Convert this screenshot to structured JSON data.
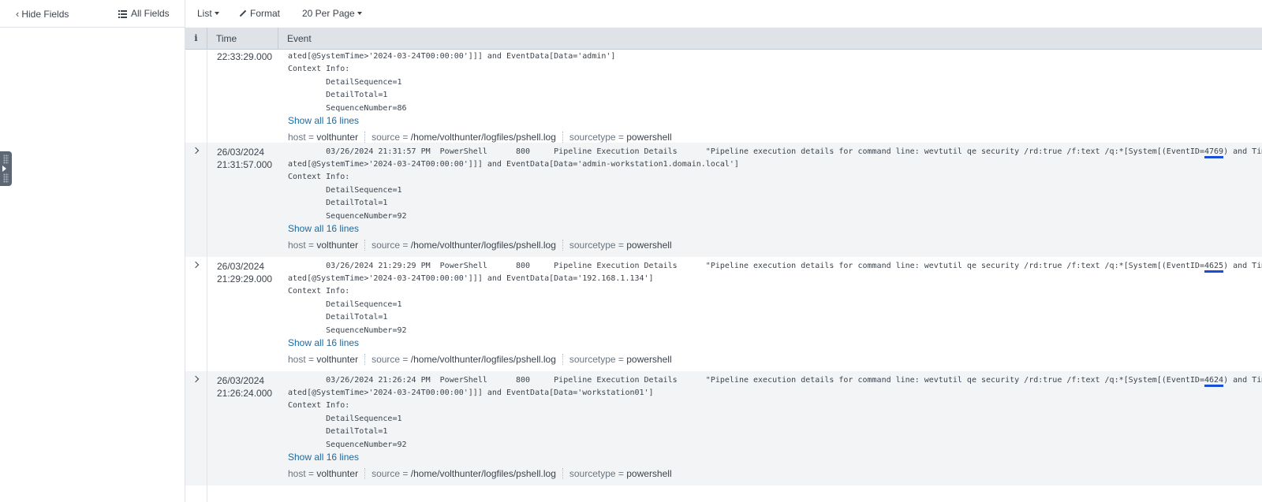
{
  "sidebar": {
    "hide_fields_label": "Hide Fields",
    "all_fields_label": "All Fields"
  },
  "toolbar": {
    "list_label": "List",
    "format_label": "Format",
    "per_page_label": "20 Per Page"
  },
  "table": {
    "info_header": "i",
    "time_header": "Time",
    "event_header": "Event"
  },
  "rows": [
    {
      "time_date": "",
      "time_clock": "22:33:29.000",
      "line1": "",
      "line2": "ated[@SystemTime>'2024-03-24T00:00:00']]] and EventData[Data='admin']",
      "ctx": "Context Info:",
      "seq": "        DetailSequence=1",
      "total": "        DetailTotal=1",
      "seqnum": "        SequenceNumber=86",
      "show_all": "Show all 16 lines",
      "host_key": "host = ",
      "host_val": "volthunter",
      "source_key": "source = ",
      "source_val": "/home/volthunter/logfiles/pshell.log",
      "sourcetype_key": "sourcetype = ",
      "sourcetype_val": "powershell"
    },
    {
      "time_date": "26/03/2024",
      "time_clock": "21:31:57.000",
      "line1_pre": "        03/26/2024 21:31:57 PM  PowerShell      800     Pipeline Execution Details      \"Pipeline execution details for command line: wevtutil qe security /rd:true /f:text /q:*[System[(EventID=",
      "line1_hl": "4769",
      "line1_post": ") and TimeCre",
      "line2": "ated[@SystemTime>'2024-03-24T00:00:00']]] and EventData[Data='admin-workstation1.domain.local']",
      "ctx": "Context Info:",
      "seq": "        DetailSequence=1",
      "total": "        DetailTotal=1",
      "seqnum": "        SequenceNumber=92",
      "show_all": "Show all 16 lines",
      "host_key": "host = ",
      "host_val": "volthunter",
      "source_key": "source = ",
      "source_val": "/home/volthunter/logfiles/pshell.log",
      "sourcetype_key": "sourcetype = ",
      "sourcetype_val": "powershell"
    },
    {
      "time_date": "26/03/2024",
      "time_clock": "21:29:29.000",
      "line1_pre": "        03/26/2024 21:29:29 PM  PowerShell      800     Pipeline Execution Details      \"Pipeline execution details for command line: wevtutil qe security /rd:true /f:text /q:*[System[(EventID=",
      "line1_hl": "4625",
      "line1_post": ") and TimeCre",
      "line2": "ated[@SystemTime>'2024-03-24T00:00:00']]] and EventData[Data='192.168.1.134']",
      "ctx": "Context Info:",
      "seq": "        DetailSequence=1",
      "total": "        DetailTotal=1",
      "seqnum": "        SequenceNumber=92",
      "show_all": "Show all 16 lines",
      "host_key": "host = ",
      "host_val": "volthunter",
      "source_key": "source = ",
      "source_val": "/home/volthunter/logfiles/pshell.log",
      "sourcetype_key": "sourcetype = ",
      "sourcetype_val": "powershell"
    },
    {
      "time_date": "26/03/2024",
      "time_clock": "21:26:24.000",
      "line1_pre": "        03/26/2024 21:26:24 PM  PowerShell      800     Pipeline Execution Details      \"Pipeline execution details for command line: wevtutil qe security /rd:true /f:text /q:*[System[(EventID=",
      "line1_hl": "4624",
      "line1_post": ") and TimeCre",
      "line2": "ated[@SystemTime>'2024-03-24T00:00:00']]] and EventData[Data='workstation01']",
      "ctx": "Context Info:",
      "seq": "        DetailSequence=1",
      "total": "        DetailTotal=1",
      "seqnum": "        SequenceNumber=92",
      "show_all": "Show all 16 lines",
      "host_key": "host = ",
      "host_val": "volthunter",
      "source_key": "source = ",
      "source_val": "/home/volthunter/logfiles/pshell.log",
      "sourcetype_key": "sourcetype = ",
      "sourcetype_val": "powershell"
    }
  ],
  "colors": {
    "link": "#1a6ba3",
    "highlight_underline": "#1a4ed8",
    "header_bg": "#dfe3e8",
    "alt_row_bg": "#f2f4f5"
  }
}
